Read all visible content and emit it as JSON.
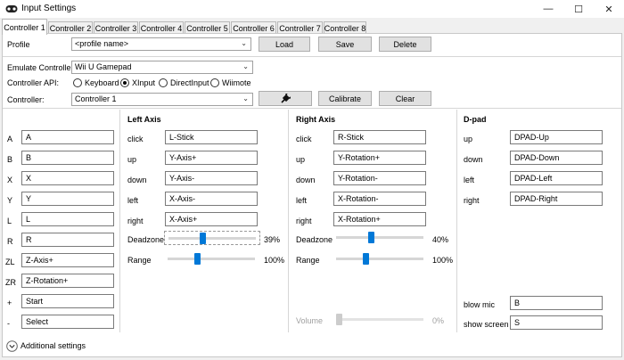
{
  "window": {
    "title": "Input Settings"
  },
  "tabs": [
    "Controller 1",
    "Controller 2",
    "Controller 3",
    "Controller 4",
    "Controller 5",
    "Controller 6",
    "Controller 7",
    "Controller 8"
  ],
  "profile": {
    "label": "Profile",
    "value": "<profile name>",
    "load": "Load",
    "save": "Save",
    "delete": "Delete"
  },
  "emulate": {
    "label": "Emulate Controller",
    "value": "Wii U Gamepad"
  },
  "api": {
    "label": "Controller API:",
    "options": [
      "Keyboard",
      "XInput",
      "DirectInput",
      "Wiimote"
    ],
    "selected": "XInput"
  },
  "controller": {
    "label": "Controller:",
    "value": "Controller 1",
    "calibrate": "Calibrate",
    "clear": "Clear"
  },
  "buttons": [
    {
      "key": "A",
      "value": "A"
    },
    {
      "key": "B",
      "value": "B"
    },
    {
      "key": "X",
      "value": "X"
    },
    {
      "key": "Y",
      "value": "Y"
    },
    {
      "key": "L",
      "value": "L"
    },
    {
      "key": "R",
      "value": "R"
    },
    {
      "key": "ZL",
      "value": "Z-Axis+"
    },
    {
      "key": "ZR",
      "value": "Z-Rotation+"
    },
    {
      "key": "+",
      "value": "Start"
    },
    {
      "key": "-",
      "value": "Select"
    }
  ],
  "left_axis": {
    "title": "Left Axis",
    "rows": [
      {
        "key": "click",
        "value": "L-Stick"
      },
      {
        "key": "up",
        "value": "Y-Axis+"
      },
      {
        "key": "down",
        "value": "Y-Axis-"
      },
      {
        "key": "left",
        "value": "X-Axis-"
      },
      {
        "key": "right",
        "value": "X-Axis+"
      }
    ],
    "deadzone": {
      "label": "Deadzone",
      "value": "39%",
      "fraction": 0.39
    },
    "range": {
      "label": "Range",
      "value": "100%",
      "fraction": 0.33
    }
  },
  "right_axis": {
    "title": "Right Axis",
    "rows": [
      {
        "key": "click",
        "value": "R-Stick"
      },
      {
        "key": "up",
        "value": "Y-Rotation+"
      },
      {
        "key": "down",
        "value": "Y-Rotation-"
      },
      {
        "key": "left",
        "value": "X-Rotation-"
      },
      {
        "key": "right",
        "value": "X-Rotation+"
      }
    ],
    "deadzone": {
      "label": "Deadzone",
      "value": "40%",
      "fraction": 0.4
    },
    "range": {
      "label": "Range",
      "value": "100%",
      "fraction": 0.33
    },
    "volume": {
      "label": "Volume",
      "value": "0%",
      "fraction": 0.0
    }
  },
  "dpad": {
    "title": "D-pad",
    "rows": [
      {
        "key": "up",
        "value": "DPAD-Up"
      },
      {
        "key": "down",
        "value": "DPAD-Down"
      },
      {
        "key": "left",
        "value": "DPAD-Left"
      },
      {
        "key": "right",
        "value": "DPAD-Right"
      }
    ],
    "blow_mic": {
      "key": "blow mic",
      "value": "B"
    },
    "show_screen": {
      "key": "show screen",
      "value": "S"
    }
  },
  "additional": {
    "label": "Additional settings"
  }
}
